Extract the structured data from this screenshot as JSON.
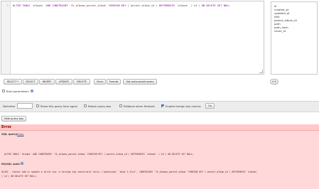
{
  "editor": {
    "line_number": "1",
    "sql": {
      "kw1": "ALTER TABLE",
      "p1": " `albums` ",
      "kw2": "ADD CONSTRAINT",
      "p2": " `fk_albums_parent_album` ",
      "kw3": "FOREIGN KEY",
      "p3": " (`parent_album_id`) ",
      "kw4": "REFERENCES",
      "p4": " `albums` (`id`) ",
      "kw5": "ON DELETE SET NULL"
    }
  },
  "columns_list": [
    "id",
    "created_at",
    "updated_at",
    "title",
    "parent_album_id",
    "path",
    "path_hash",
    "cover_id"
  ],
  "insert_button_label": "<<",
  "query_buttons": {
    "select_star": "SELECT *",
    "select": "SELECT",
    "insert": "INSERT",
    "update": "UPDATE",
    "delete": "DELETE",
    "clear": "Clear",
    "format": "Format",
    "get_saved": "Get auto-saved query"
  },
  "bind_parameters": {
    "label": "Bind parameters",
    "checked": false
  },
  "options": {
    "delimiter_label": "Delimiter",
    "delimiter_value": "",
    "show_query_again": {
      "label": "Show this query here again",
      "checked": false
    },
    "retain_query_box": {
      "label": "Retain query box",
      "checked": false
    },
    "rollback_when_finished": {
      "label": "Rollback when finished",
      "checked": false
    },
    "enable_fk_checks": {
      "label": "Enable foreign key checks",
      "checked": true
    },
    "go_label": "Go"
  },
  "hide_query_box_label": "Hide query box",
  "error": {
    "title": "Error",
    "sql_query_label": "SQL query:",
    "copy_link": "Copy",
    "query_text": "ALTER TABLE `albums` ADD CONSTRAINT `fk_albums_parent_album` FOREIGN KEY (`parent_album_id`) REFERENCES `albums` (`id`) ON DELETE SET NULL;",
    "mysql_said_label": "MySQL said:",
    "message_line1": "#1452 - Cannot add or update a child row: a foreign key constraint fails (`photoview`.`#sql-1_51c4`, CONSTRAINT `fk_albums_parent_album` FOREIGN KEY (`parent_album_id`) REFERENCES `albums`",
    "message_line2": "(`id`) ON DELETE SET NULL)"
  },
  "colors": {
    "error_bg": "#ffd9d9",
    "error_title": "#8a0000",
    "accent": "#3d7bd6"
  }
}
